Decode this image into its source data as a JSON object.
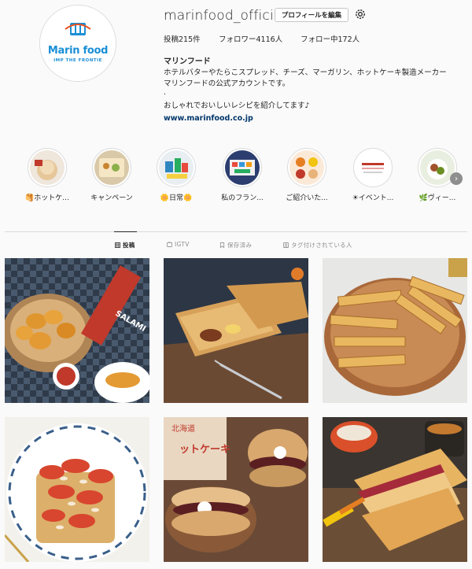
{
  "profile": {
    "username": "marinfood_official",
    "edit_button": "プロフィールを編集",
    "settings_icon": "gear-icon",
    "logo_text": "Marin food",
    "logo_tagline": "IMP THE FRONTIE"
  },
  "stats": {
    "posts": "投稿215件",
    "followers": "フォロワー4116人",
    "following": "フォロー中172人"
  },
  "bio": {
    "name": "マリンフード",
    "line1": "ホテルバターやたらこスプレッド、チーズ、マーガリン、ホットケーキ製造メーカー",
    "line2": "マリンフードの公式アカウントです。",
    "line3": ".",
    "line4": "おしゃれでおいしいレシピを紹介してます♪",
    "link": "www.marinfood.co.jp"
  },
  "highlights": [
    {
      "label": "🥞ホットケ..."
    },
    {
      "label": "キャンペーン"
    },
    {
      "label": "🌼日常🌼"
    },
    {
      "label": "私のフラン..."
    },
    {
      "label": "ご紹介いた..."
    },
    {
      "label": "☀イベント..."
    },
    {
      "label": "🌿ヴィー..."
    }
  ],
  "tabs": {
    "posts": "投稿",
    "igtv": "IGTV",
    "saved": "保存済み",
    "tagged": "タグ付けされている人"
  },
  "colors": {
    "link": "#00376b",
    "muted": "#8e8e8e",
    "border": "#dbdbdb",
    "logo_blue": "#1b8fd6",
    "logo_orange": "#e8501e"
  }
}
